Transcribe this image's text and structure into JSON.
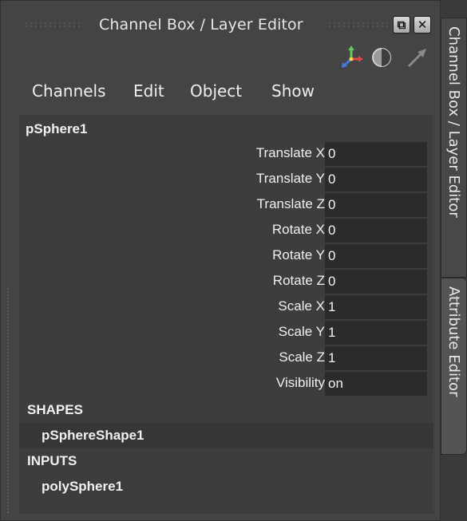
{
  "window": {
    "title": "Channel Box / Layer Editor",
    "float_glyph": "⧉",
    "close_glyph": "✕"
  },
  "toolbar_icons": [
    "axis-manipulator-icon",
    "shading-icon",
    "arrow-icon"
  ],
  "menu": {
    "channels": "Channels",
    "edit": "Edit",
    "object": "Object",
    "show": "Show"
  },
  "node": {
    "name": "pSphere1",
    "attributes": [
      {
        "label": "Translate X",
        "value": "0"
      },
      {
        "label": "Translate Y",
        "value": "0"
      },
      {
        "label": "Translate Z",
        "value": "0"
      },
      {
        "label": "Rotate X",
        "value": "0"
      },
      {
        "label": "Rotate Y",
        "value": "0"
      },
      {
        "label": "Rotate Z",
        "value": "0"
      },
      {
        "label": "Scale X",
        "value": "1"
      },
      {
        "label": "Scale Y",
        "value": "1"
      },
      {
        "label": "Scale Z",
        "value": "1"
      },
      {
        "label": "Visibility",
        "value": "on"
      }
    ]
  },
  "shapes": {
    "header": "SHAPES",
    "items": [
      "pSphereShape1"
    ]
  },
  "inputs": {
    "header": "INPUTS",
    "items": [
      "polySphere1"
    ]
  },
  "side_tabs": {
    "channel_box": "Channel Box / Layer Editor",
    "attribute_editor": "Attribute Editor"
  },
  "colors": {
    "panel_bg": "#444444",
    "content_bg": "#3d3d3d",
    "field_bg": "#2b2b2b",
    "text": "#f0f0f0"
  }
}
